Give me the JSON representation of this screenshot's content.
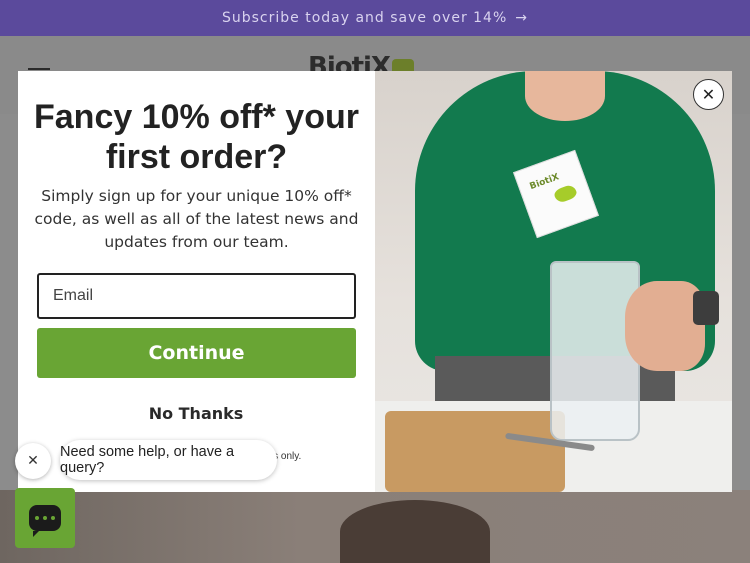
{
  "announcement": {
    "text": "Subscribe today and save over 14%",
    "arrow": "→"
  },
  "header": {
    "logo": "BiotiX"
  },
  "popup": {
    "title": "Fancy 10% off* your first order?",
    "description": "Simply sign up for your unique 10% off* code, as well as all of the latest news and updates from our team.",
    "email_placeholder": "Email",
    "continue_label": "Continue",
    "no_thanks_label": "No Thanks",
    "disclaimer": "customers only.",
    "close_label": "✕",
    "sachet_label": "BiotiX"
  },
  "chat": {
    "message": "Need some help, or have a query?",
    "dismiss_label": "✕"
  },
  "colors": {
    "accent_green": "#69a534",
    "announce_purple": "#5b4a9c"
  }
}
